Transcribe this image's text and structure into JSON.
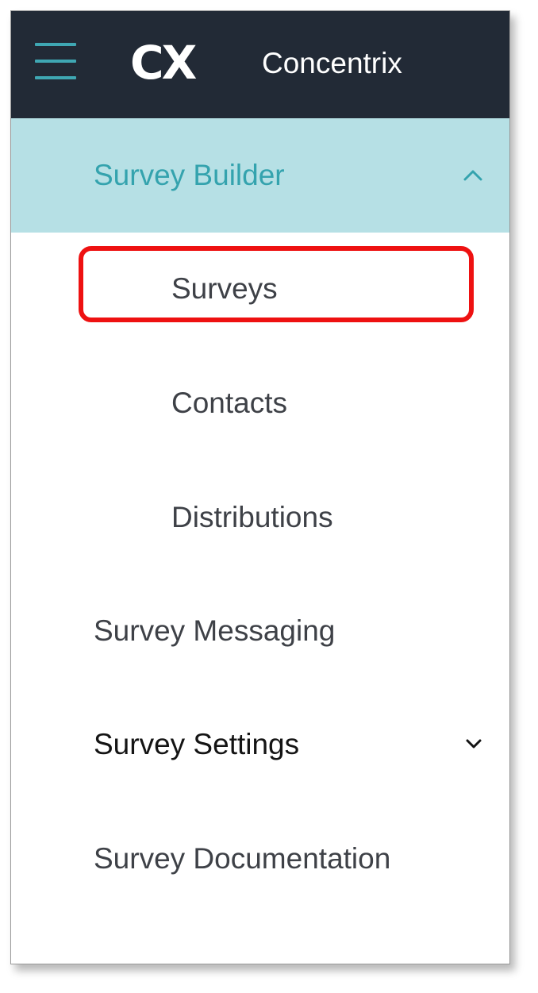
{
  "header": {
    "logo_text": "CX",
    "brand_name": "Concentrix",
    "menu_icon": "hamburger-menu-icon",
    "background_color": "#222a36",
    "accent_color": "#3fa7b3"
  },
  "nav": {
    "active_section": {
      "label": "Survey Builder",
      "expanded": true,
      "icon": "chevron-up-icon",
      "background_color": "#b6e0e5",
      "text_color": "#34a3ae"
    },
    "sub_items": [
      {
        "label": "Surveys",
        "highlighted": true
      },
      {
        "label": "Contacts"
      },
      {
        "label": "Distributions"
      }
    ],
    "items": [
      {
        "label": "Survey Messaging"
      },
      {
        "label": "Survey Settings",
        "icon": "chevron-down-icon",
        "expanded": false
      },
      {
        "label": "Survey Documentation"
      }
    ],
    "highlight_color": "#ee1111"
  }
}
